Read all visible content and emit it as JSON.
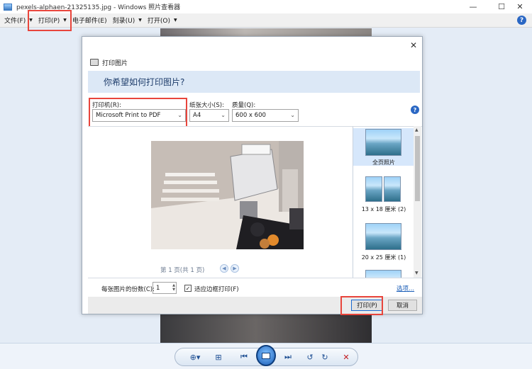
{
  "window": {
    "title": "pexels-alphaen-21325135.jpg - Windows 照片查看器",
    "min": "—",
    "max": "☐",
    "close": "✕"
  },
  "menubar": {
    "items": [
      {
        "label": "文件(F)"
      },
      {
        "label": "打印(P)"
      },
      {
        "label": "电子邮件(E)"
      },
      {
        "label": "刻录(U)"
      },
      {
        "label": "打开(O)"
      }
    ],
    "help": "?"
  },
  "dialog": {
    "title": "打印图片",
    "close": "✕",
    "question": "你希望如何打印图片?",
    "printer_label": "打印机(R):",
    "printer_value": "Microsoft Print to PDF",
    "paper_label": "纸张大小(S):",
    "paper_value": "A4",
    "quality_label": "质量(Q):",
    "quality_value": "600 x 600",
    "help": "?",
    "page_info": "第 1 页(共 1 页)",
    "layouts": [
      {
        "label": "全页照片",
        "selected": true
      },
      {
        "label": "13 x 18 厘米 (2)",
        "selected": false
      },
      {
        "label": "20 x 25 厘米 (1)",
        "selected": false
      }
    ],
    "copies_label": "每张图片的份数(C):",
    "copies_value": "1",
    "fit_label": "适应边框打印(F)",
    "fit_checked": "✓",
    "options_link": "选项...",
    "print_button": "打印(P)",
    "cancel_button": "取消"
  },
  "colors": {
    "highlight": "#e8453c",
    "accent": "#2a67c4"
  },
  "icons": [
    "app-icon",
    "help-icon",
    "printer-icon",
    "zoom-icon",
    "fit-window-icon",
    "previous-icon",
    "slideshow-icon",
    "next-icon",
    "rotate-left-icon",
    "rotate-right-icon",
    "delete-icon"
  ]
}
